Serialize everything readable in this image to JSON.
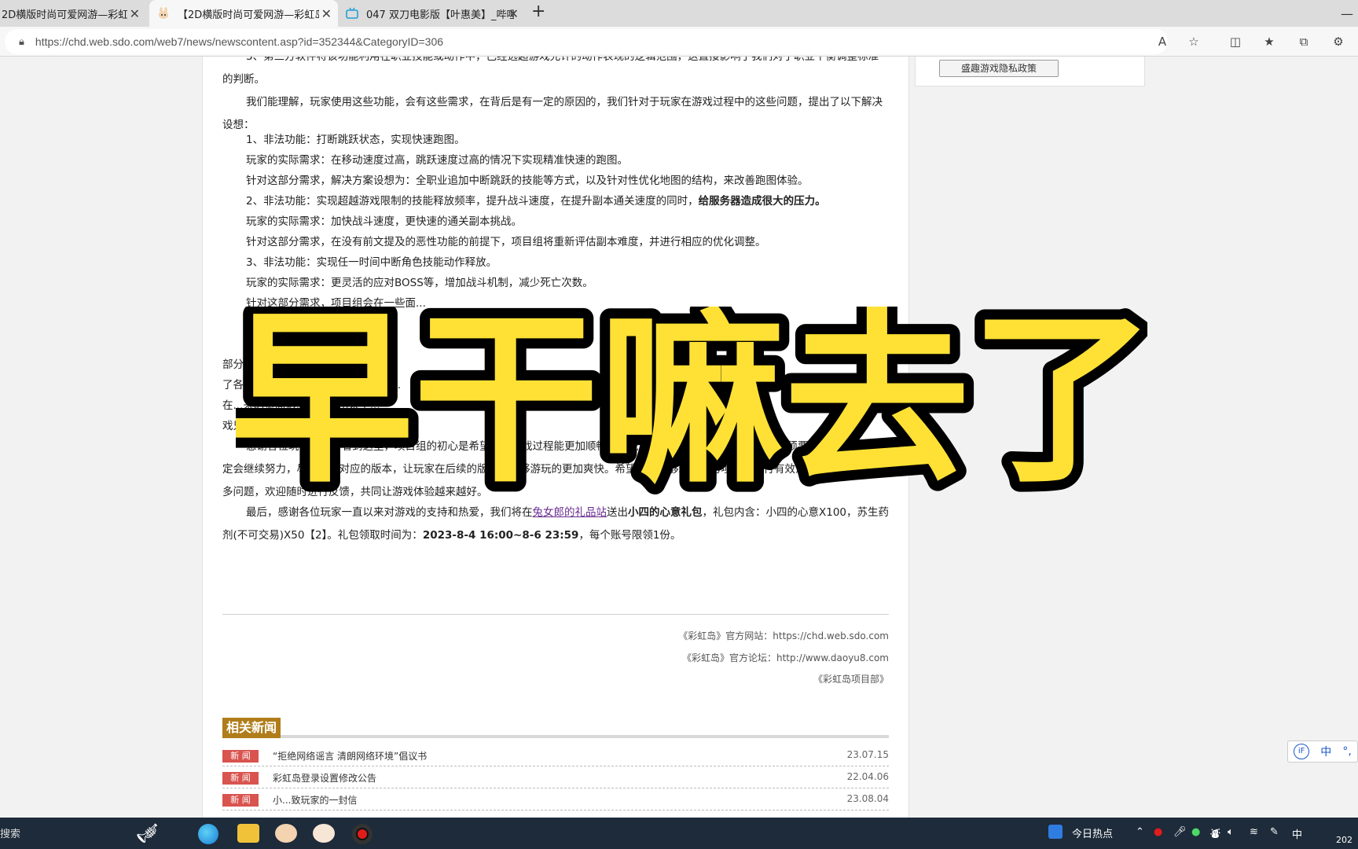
{
  "browser": {
    "tabs": [
      {
        "title": "2D横版时尚可爱网游—彩虹岛",
        "active": false
      },
      {
        "title": "【2D横版时尚可爱网游—彩虹岛",
        "active": true
      },
      {
        "title": "047 双刀电影版【叶惠美】_哔哩",
        "active": false
      }
    ],
    "new_tab_label": "+",
    "url": "https://chd.web.sdo.com/web7/news/newscontent.asp?id=352344&CategoryID=306"
  },
  "sidebar": {
    "privacy_button": "盛趣游戏隐私政策"
  },
  "article": {
    "paragraphs": [
      "3、第三方软件将该功能利用在职业技能或动作中，已经远超游戏允许的动作表现的逻辑范围，这直接影响了我们对于职业平衡调整标准的判断。",
      "我们能理解，玩家使用这些功能，会有这些需求，在背后是有一定的原因的，我们针对于玩家在游戏过程中的这些问题，提出了以下解决设想：",
      "1、非法功能：打断跳跃状态，实现快速跑图。",
      "玩家的实际需求：在移动速度过高，跳跃速度过高的情况下实现精准快速的跑图。",
      "针对这部分需求，解决方案设想为：全职业追加中断跳跃的技能等方式，以及针对性优化地图的结构，来改善跑图体验。",
      "2、非法功能：实现超越游戏限制的技能释放频率，提升战斗速度，在提升副本通关速度的同时，",
      "给服务器造成很大的压力。",
      "玩家的实际需求：加快战斗速度，更快速的通关副本挑战。",
      "针对这部分需求，在没有前文提及的恶性功能的前提下，项目组将重新评估副本难度，并进行相应的优化调整。",
      "3、非法功能：实现任一时间中断角色技能动作释放。",
      "玩家的实际需求：更灵活的应对BOSS等，增加战斗机制，减少死亡次数。",
      "针对这部分需求，项目组会在一些面...",
      "关...",
      "希...",
      "部分...",
      "了各...游戏内正常...同时能...的功能...",
      "在...来的负面影...上延伸出来了...",
      "戏只会有害无利。",
      "感谢各位玩家耐心的看到这里，项目组的初心是希望玩家游戏过程能更加顺畅和愉悦，因此恶性功能引发的问题是必须要修复的，我们一定会继续努力，尽快推出对应的版本，让玩家在后续的版本中能够游玩的更加爽快。希望玩家能够理性的与项目组进行有效沟通，如果还有更多问题，欢迎随时进行反馈，共同让游戏体验越来越好。",
      "最后，感谢各位玩家一直以来对游戏的支持和热爱，我们将在",
      "兔女郎的礼品站",
      "送出",
      "小四的心意礼包",
      "，礼包内含：小四的心意X100，苏生药剂(不可交易)X50【2】。礼包领取时间为：",
      "2023-8-4 16:00~8-6 23:59",
      "，每个账号限领1份。"
    ],
    "footer": [
      "《彩虹岛》官方网站：https://chd.web.sdo.com",
      "《彩虹岛》官方论坛：http://www.daoyu8.com",
      "《彩虹岛项目部》"
    ]
  },
  "related": {
    "title": "相关新闻",
    "items": [
      {
        "tag": "新 闻",
        "title": "“拒绝网络谣言 清朗网络环境”倡议书",
        "date": "23.07.15"
      },
      {
        "tag": "新 闻",
        "title": "彩虹岛登录设置修改公告",
        "date": "22.04.06"
      },
      {
        "tag": "新 闻",
        "title": "小...致玩家的一封信",
        "date": "23.08.04"
      }
    ]
  },
  "overlay": {
    "text": "早干嘛去了",
    "fill": "#ffe135",
    "stroke": "#000000"
  },
  "ime": {
    "lang": "中",
    "punct": "°,"
  },
  "taskbar": {
    "search": "搜索",
    "hot": "今日热点",
    "lang": "中",
    "year": "202"
  },
  "colors": {
    "tag_red": "#d9534f",
    "related_gold": "#b07d1a",
    "link_purple": "#6a2c91"
  }
}
